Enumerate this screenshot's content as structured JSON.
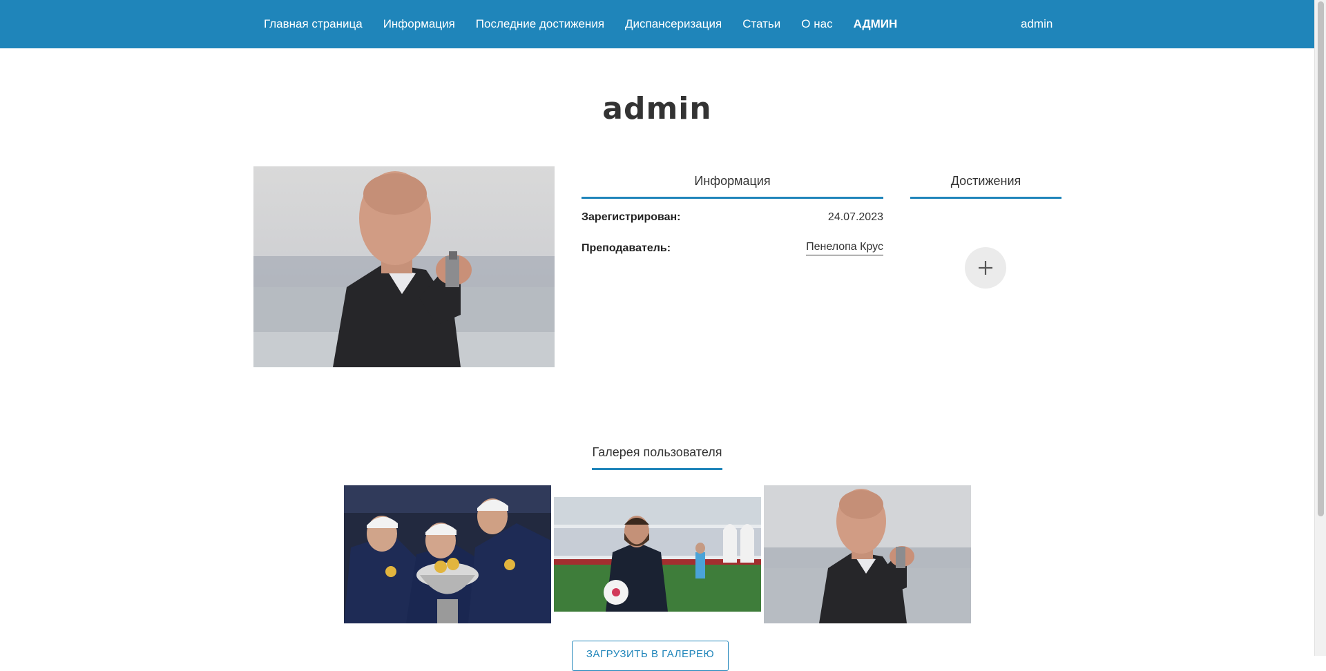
{
  "nav": {
    "items": [
      {
        "label": "Главная страница"
      },
      {
        "label": "Информация"
      },
      {
        "label": "Последние достижения"
      },
      {
        "label": "Диспансеризация"
      },
      {
        "label": "Статьи"
      },
      {
        "label": "О нас"
      },
      {
        "label": "АДМИН"
      }
    ],
    "user": "admin"
  },
  "profile": {
    "title": "admin",
    "tabs": {
      "info": "Информация",
      "achievements": "Достижения"
    },
    "registered_label": "Зарегистрирован:",
    "registered_value": "24.07.2023",
    "teacher_label": "Преподаватель:",
    "teacher_value": "Пенелопа Крус"
  },
  "gallery": {
    "title": "Галерея пользователя",
    "upload_label": "ЗАГРУЗИТЬ В ГАЛЕРЕЮ"
  },
  "colors": {
    "accent": "#1f85ba",
    "text": "#333333"
  }
}
